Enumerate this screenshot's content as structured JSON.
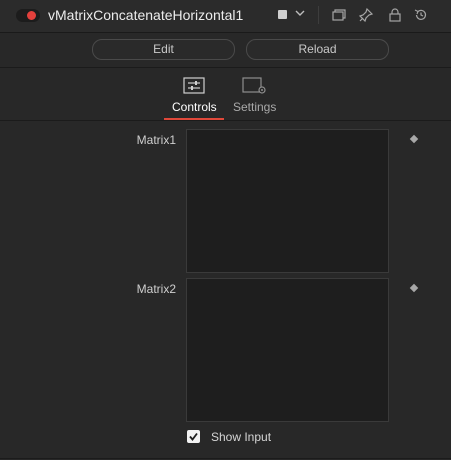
{
  "header": {
    "title": "vMatrixConcatenateHorizontal1",
    "enabled": true,
    "accent_color": "#e2403c",
    "icons": [
      "toggle",
      "color-swatch",
      "chevron-down-icon",
      "version-icon",
      "pin-icon",
      "lock-icon",
      "reset-icon"
    ]
  },
  "actions": {
    "edit_label": "Edit",
    "reload_label": "Reload"
  },
  "tabs": [
    {
      "label": "Controls",
      "active": true,
      "icon": "sliders-icon"
    },
    {
      "label": "Settings",
      "active": false,
      "icon": "settings-icon"
    }
  ],
  "fields": {
    "matrix1_label": "Matrix1",
    "matrix2_label": "Matrix2"
  },
  "show_input": {
    "label": "Show Input",
    "checked": true
  }
}
